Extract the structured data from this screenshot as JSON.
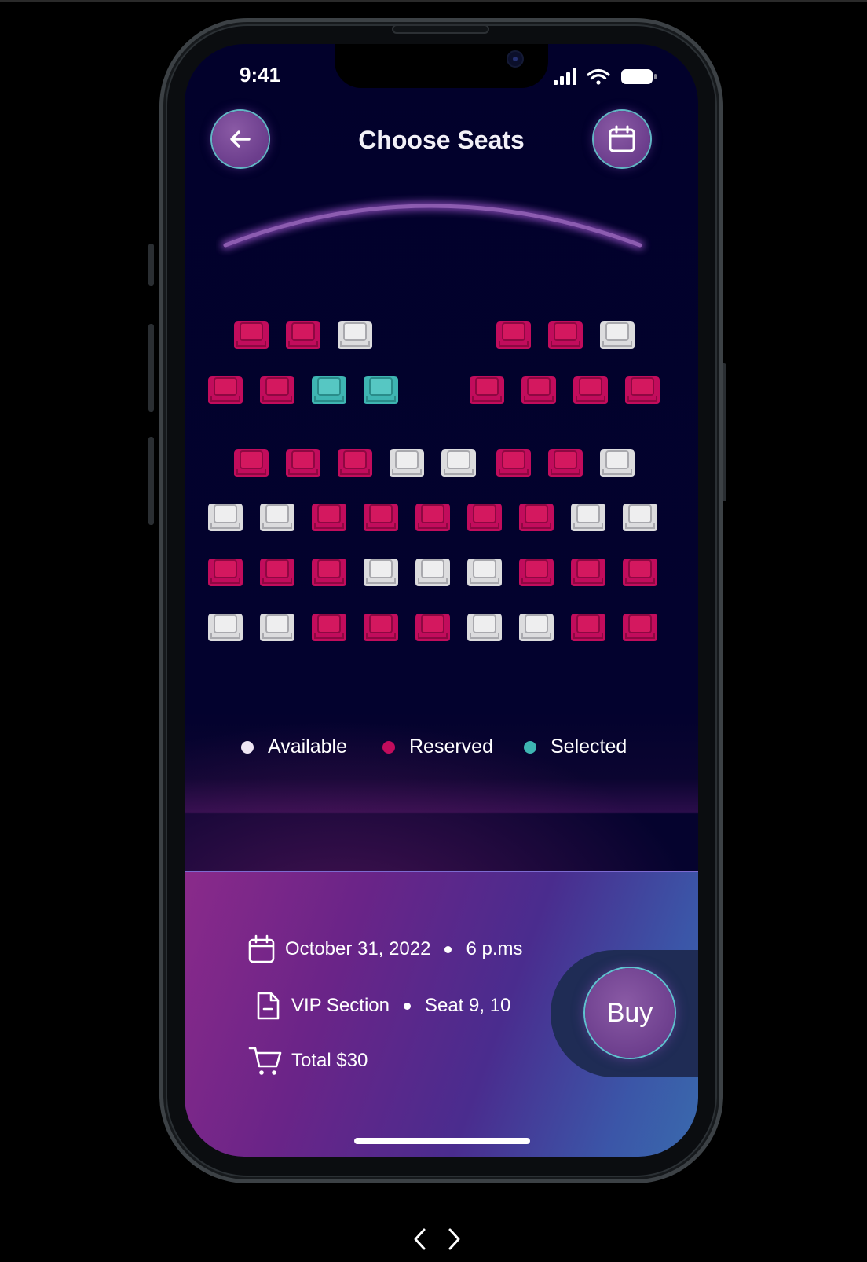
{
  "status_bar": {
    "time": "9:41"
  },
  "header": {
    "title": "Choose Seats"
  },
  "colors": {
    "available": "#dcdcde",
    "reserved": "#c20c5c",
    "selected": "#3eb5b2",
    "accent_purple": "#7a4a9a",
    "background": "#02012b"
  },
  "seat_rows": [
    [
      "reserved",
      "reserved",
      "available",
      "reserved",
      "reserved",
      "available"
    ],
    [
      "reserved",
      "reserved",
      "selected",
      "selected",
      "reserved",
      "reserved",
      "reserved",
      "reserved"
    ],
    [
      "reserved",
      "reserved",
      "reserved",
      "available",
      "available",
      "reserved",
      "reserved",
      "available"
    ],
    [
      "available",
      "available",
      "reserved",
      "reserved",
      "reserved",
      "reserved",
      "reserved",
      "available",
      "available"
    ],
    [
      "reserved",
      "reserved",
      "reserved",
      "available",
      "available",
      "available",
      "reserved",
      "reserved",
      "reserved"
    ],
    [
      "available",
      "available",
      "reserved",
      "reserved",
      "reserved",
      "available",
      "available",
      "reserved",
      "reserved"
    ]
  ],
  "legend": {
    "available": "Available",
    "reserved": "Reserved",
    "selected": "Selected"
  },
  "booking": {
    "date": "October 31, 2022",
    "time": "6 p.ms",
    "section": "VIP Section",
    "seats": "Seat 9, 10",
    "total": "Total $30",
    "buy_label": "Buy"
  }
}
